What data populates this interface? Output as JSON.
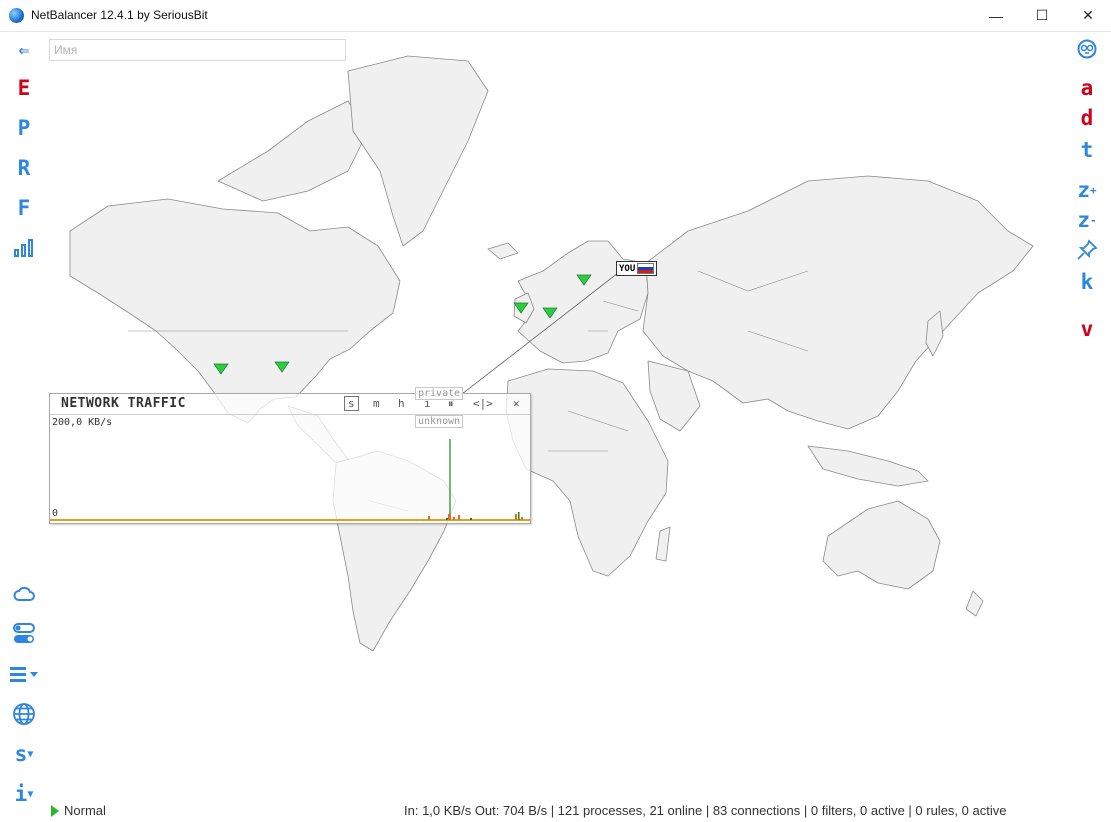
{
  "window": {
    "title": "NetBalancer 12.4.1 by SeriousBit",
    "controls": {
      "minimize": "—",
      "maximize": "☐",
      "close": "✕"
    }
  },
  "search": {
    "placeholder": "Имя",
    "value": ""
  },
  "left_toolbar": {
    "back": "⇐",
    "edit": "E",
    "priorities": "P",
    "rules": "R",
    "filters": "F",
    "more": "s",
    "info": "i"
  },
  "right_toolbar": {
    "a": "a",
    "d": "d",
    "t": "t",
    "zoom_in": "z",
    "zoom_in_sup": "+",
    "zoom_out": "z",
    "zoom_out_sup": "-",
    "k": "k",
    "v": "v"
  },
  "traffic_widget": {
    "title": "NETWORK TRAFFIC",
    "controls": [
      "s",
      "m",
      "h",
      "i",
      "⏸",
      "<|>",
      "✕"
    ],
    "selected_control": "s",
    "scale_max": "200,0 KB/s",
    "scale_zero": "0",
    "tags": {
      "private": "private",
      "unknown": "unknown"
    }
  },
  "map": {
    "you_label": "YOU",
    "country": "Russia",
    "marker_color": "#2ecc40",
    "connection_markers": 5
  },
  "status": {
    "mode": "Normal",
    "stats": "In: 1,0 KB/s  Out: 704 B/s  |  121 processes, 21 online  | 83 connections  | 0 filters, 0 active  |  0 rules, 0 active"
  },
  "colors": {
    "accent": "#2e86de",
    "alert": "#d0021b",
    "status_ok": "#2bb52b"
  }
}
